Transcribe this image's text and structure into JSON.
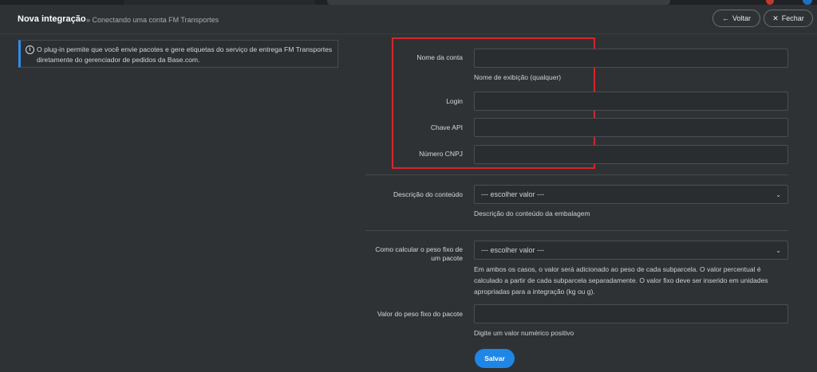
{
  "header": {
    "title": "Nova integração",
    "subtitle": "» Conectando uma conta FM Transportes",
    "back_label": "Voltar",
    "close_label": "Fechar"
  },
  "info": {
    "text": "O plug-in permite que você envie pacotes e gere etiquetas do serviço de entrega FM Transportes diretamente do gerenciador de pedidos da Base.com."
  },
  "form": {
    "account_name_label": "Nome da conta",
    "account_name_value": "",
    "account_name_help": "Nome de exibição (qualquer)",
    "login_label": "Login",
    "login_value": "",
    "api_key_label": "Chave API",
    "api_key_value": "",
    "cnpj_label": "Número CNPJ",
    "cnpj_value": "",
    "content_desc_label": "Descrição do conteúdo",
    "content_desc_value": "--- escolher valor ---",
    "content_desc_help": "Descrição do conteúdo da embalagem",
    "fixed_weight_calc_label": "Como calcular o peso fixo de um pacote",
    "fixed_weight_calc_value": "--- escolher valor ---",
    "fixed_weight_calc_help": "Em ambos os casos, o valor será adicionado ao peso de cada subparcela. O valor percentual é calculado a partir de cada subparcela separadamente. O valor fixo deve ser inserido em unidades apropriadas para a integração (kg ou g).",
    "fixed_weight_value_label": "Valor do peso fixo do pacote",
    "fixed_weight_value_value": "",
    "fixed_weight_value_help": "Digite um valor numérico positivo",
    "save_label": "Salvar"
  },
  "icons": {
    "back": "arrow-left-icon",
    "close": "close-icon",
    "info": "info-icon",
    "chevron": "chevron-down-icon"
  },
  "colors": {
    "background": "#2f3235",
    "accent": "#1f86e6",
    "highlight": "#d4262c"
  }
}
